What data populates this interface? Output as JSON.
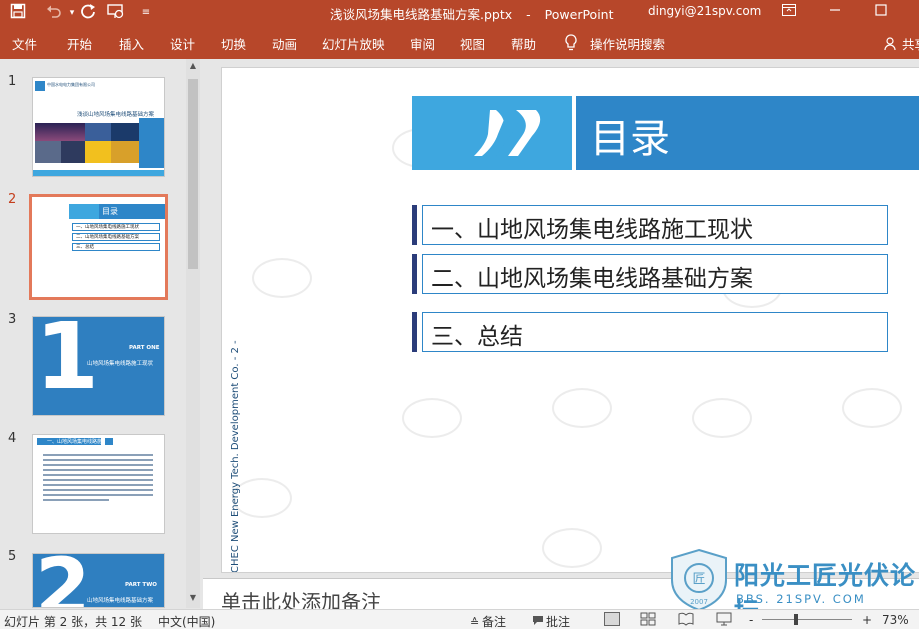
{
  "titlebar": {
    "filename": "浅谈风场集电线路基础方案.pptx",
    "separator": "-",
    "app": "PowerPoint",
    "account": "dingyi@21spv.com"
  },
  "ribbon": {
    "tabs": [
      "文件",
      "开始",
      "插入",
      "设计",
      "切换",
      "动画",
      "幻灯片放映",
      "审阅",
      "视图",
      "帮助"
    ],
    "tell_me": "操作说明搜索",
    "share": "共享"
  },
  "thumbnails": {
    "numbers": [
      "1",
      "2",
      "3",
      "4",
      "5"
    ],
    "selected_index": 2,
    "t1": {
      "company": "中国水电电力集团有限公司",
      "title": "浅谈山地风场集电线路基础方案"
    },
    "t2": {
      "title": "目录",
      "items": [
        "一、山地风场集电线路施工现状",
        "二、山地风场集电线路基础方案",
        "三、总结"
      ]
    },
    "t3": {
      "numeral": "1",
      "part": "PART ONE",
      "subtitle": "山地风场集电线路施工现状"
    },
    "t4": {
      "heading": "一、山地风场集电线路施工现状"
    },
    "t5": {
      "numeral": "2",
      "part": "PART TWO",
      "subtitle": "山地风场集电线路基础方案"
    }
  },
  "slide": {
    "title": "目录",
    "items": [
      "一、山地风场集电线路施工现状",
      "二、山地风场集电线路基础方案",
      "三、总结"
    ],
    "vertical_text": "CHEC New Energy Tech. Development Co. - 2 -"
  },
  "notes": {
    "placeholder": "单击此处添加备注"
  },
  "statusbar": {
    "slide_info": "幻灯片 第 2 张，共 12 张",
    "language": "中文(中国)",
    "notes_label": "备注",
    "comments_label": "批注",
    "zoom_minus": "-",
    "zoom_plus": "+",
    "zoom": "73%",
    "zoom_level_percent": 73
  },
  "watermark": {
    "name": "阳光工匠光伏论坛",
    "url": "BBS. 21SPV. COM",
    "year": "2007"
  },
  "colors": {
    "accent": "#b7472a",
    "slide_blue": "#2e86c8",
    "selected_border": "#e3795a"
  }
}
